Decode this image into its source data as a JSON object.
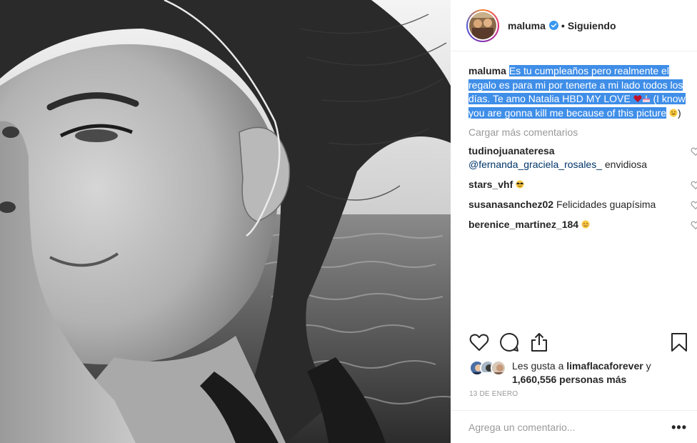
{
  "header": {
    "username": "maluma",
    "separator": "•",
    "follow_state": "Siguiendo",
    "verified_icon": "verified-badge-icon"
  },
  "caption": {
    "username": "maluma",
    "text_part1": "Es tu cumpleaños pero realmente el regalo es para mi por tenerte a mi lado todos los días. Te amo Natalia HBD MY LOVE",
    "text_part2": "(I know you are gonna kill me because of this picture",
    "text_end": ")",
    "emojis": [
      "heart-emoji",
      "cake-emoji",
      "grinning-emoji"
    ]
  },
  "load_more": "Cargar más comentarios",
  "comments": [
    {
      "user": "tudinojuanateresa",
      "mention": "@fernanda_graciela_rosales_",
      "text": "envidiosa"
    },
    {
      "user": "stars_vhf",
      "mention": "",
      "text": "",
      "emoji": "sunglasses-emoji"
    },
    {
      "user": "susanasanchez02",
      "mention": "",
      "text": "Felicidades guapísima"
    },
    {
      "user": "berenice_martinez_184",
      "mention": "",
      "text": "",
      "emoji": "smile-emoji"
    }
  ],
  "actions": [
    "heart-icon",
    "comment-icon",
    "share-icon",
    "bookmark-icon"
  ],
  "likes": {
    "prefix": "Les gusta a",
    "liker": "limaflacaforever",
    "conj": "y",
    "count": "1,660,556 personas más"
  },
  "date": "13 DE ENERO",
  "add_comment": {
    "placeholder": "Agrega un comentario...",
    "more": "•••"
  },
  "colors": {
    "highlight": "#3f8ee8",
    "verified": "#3897f0",
    "muted": "#999999",
    "text": "#262626"
  }
}
